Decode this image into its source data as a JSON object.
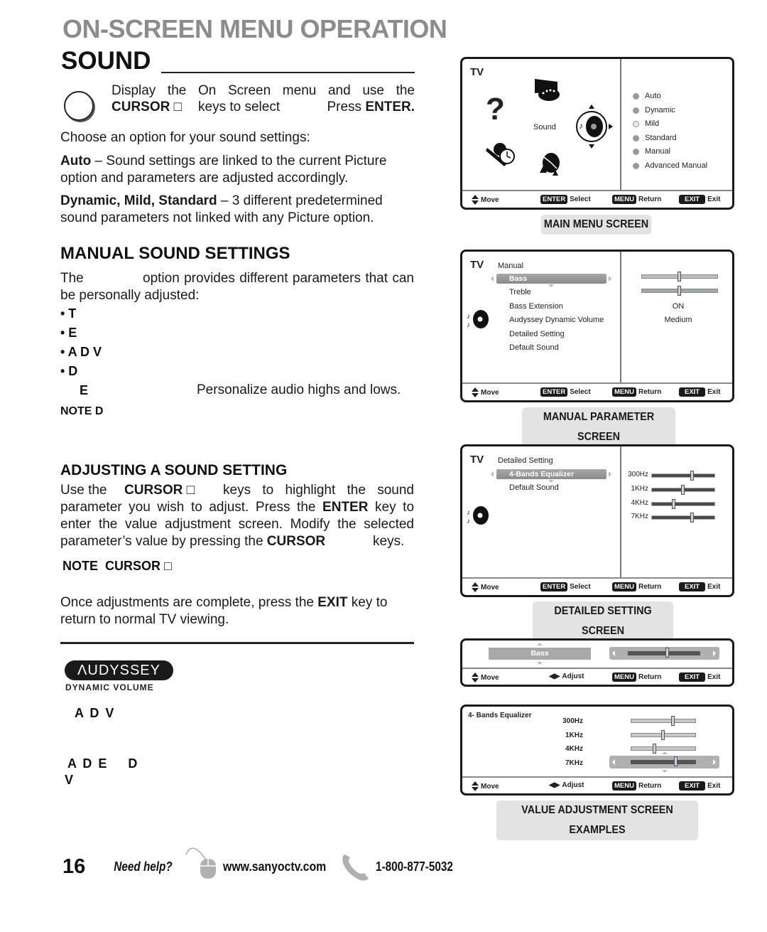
{
  "header": {
    "section": "ON-SCREEN MENU OPERATION",
    "title": "SOUND"
  },
  "intro": {
    "line1": "Display the On Screen menu and use the",
    "line2_bold": "CURSOR □",
    "line2_mid": "keys to select",
    "line2_end_pre": "Press",
    "line2_end_bold": "ENTER.",
    "choose": "Choose an option for your sound settings:",
    "auto_bold": "Auto",
    "auto_text": " – Sound settings are linked to the current Picture option and parameters are adjusted accordingly.",
    "dyn_bold": "Dynamic, Mild, Standard",
    "dyn_text": " – 3 different predetermined sound parameters not linked with any Picture option."
  },
  "manual": {
    "heading": "MANUAL SOUND SETTINGS",
    "para_start": "The",
    "para_rest": "option provides different parameters that can be personally adjusted:",
    "bullets": [
      "•   T",
      "•  E",
      "• A D V",
      "• D"
    ],
    "sub_bold": "E",
    "sub_text": "Personalize audio highs and lows.",
    "note": "NOTE D"
  },
  "adjusting": {
    "heading": "ADJUSTING A SOUND SETTING",
    "l1_a": "Use the",
    "l1_b": "CURSOR □",
    "l1_c": "keys to highlight the sound",
    "l2_a": "parameter you wish to adjust. Press the",
    "l2_b": "ENTER",
    "l2_c": "key to",
    "l3": "enter the value adjustment screen. Modify the selected",
    "l4_a": "parameter’s value by pressing the",
    "l4_b": "CURSOR",
    "l4_c": "keys.",
    "note_a": "NOTE",
    "note_b": "CURSOR □",
    "exit_a": "Once adjustments are complete, press the",
    "exit_b": "EXIT",
    "exit_c": "key to return to normal TV viewing."
  },
  "audyssey": {
    "logo": "ΛUDYSSEY",
    "sub": "DYNAMIC VOLUME",
    "t1": "A D V",
    "t2": "A D E    D",
    "t3": "V"
  },
  "common_footer": {
    "move": "Move",
    "enter_key": "ENTER",
    "select": "Select",
    "menu_key": "MENU",
    "return": "Return",
    "exit_key": "EXIT",
    "exit": "Exit",
    "adjust": "Adjust"
  },
  "main_menu_screen": {
    "tv": "TV",
    "center_label": "Sound",
    "options": [
      "Auto",
      "Dynamic",
      "Mild",
      "Standard",
      "Manual",
      "Advanced Manual"
    ],
    "selected_option": "Mild",
    "caption": "MAIN MENU SCREEN"
  },
  "manual_param_screen": {
    "tv": "TV",
    "title": "Manual",
    "items": [
      "Bass",
      "Treble",
      "Bass Extension",
      "Audyssey Dynamic Volume",
      "Detailed Setting",
      "Default Sound"
    ],
    "selected": "Bass",
    "values": {
      "bass_level": 0.5,
      "treble_level": 0.5,
      "bass_extension": "ON",
      "audyssey": "Medium"
    },
    "caption": "MANUAL PARAMETER SCREEN"
  },
  "detailed_screen": {
    "tv": "TV",
    "title": "Detailed Setting",
    "items": [
      "4-Bands Equalizer",
      "Default Sound"
    ],
    "selected": "4-Bands Equalizer",
    "bands": [
      {
        "label": "300Hz",
        "level": 0.65
      },
      {
        "label": "1KHz",
        "level": 0.5
      },
      {
        "label": "4KHz",
        "level": 0.35
      },
      {
        "label": "7KHz",
        "level": 0.65
      }
    ],
    "caption": "DETAILED SETTING SCREEN"
  },
  "value_bass_screen": {
    "label": "Bass",
    "level": 0.55
  },
  "value_eq_screen": {
    "title": "4- Bands Equalizer",
    "bands": [
      {
        "label": "300Hz",
        "level": 0.65
      },
      {
        "label": "1KHz",
        "level": 0.5
      },
      {
        "label": "4KHz",
        "level": 0.37
      },
      {
        "label": "7KHz",
        "level": 0.7
      }
    ],
    "caption": "VALUE ADJUSTMENT SCREEN EXAMPLES"
  },
  "page_footer": {
    "page_number": "16",
    "need_help": "Need help?",
    "website": "www.sanyoctv.com",
    "phone": "1-800-877-5032"
  }
}
